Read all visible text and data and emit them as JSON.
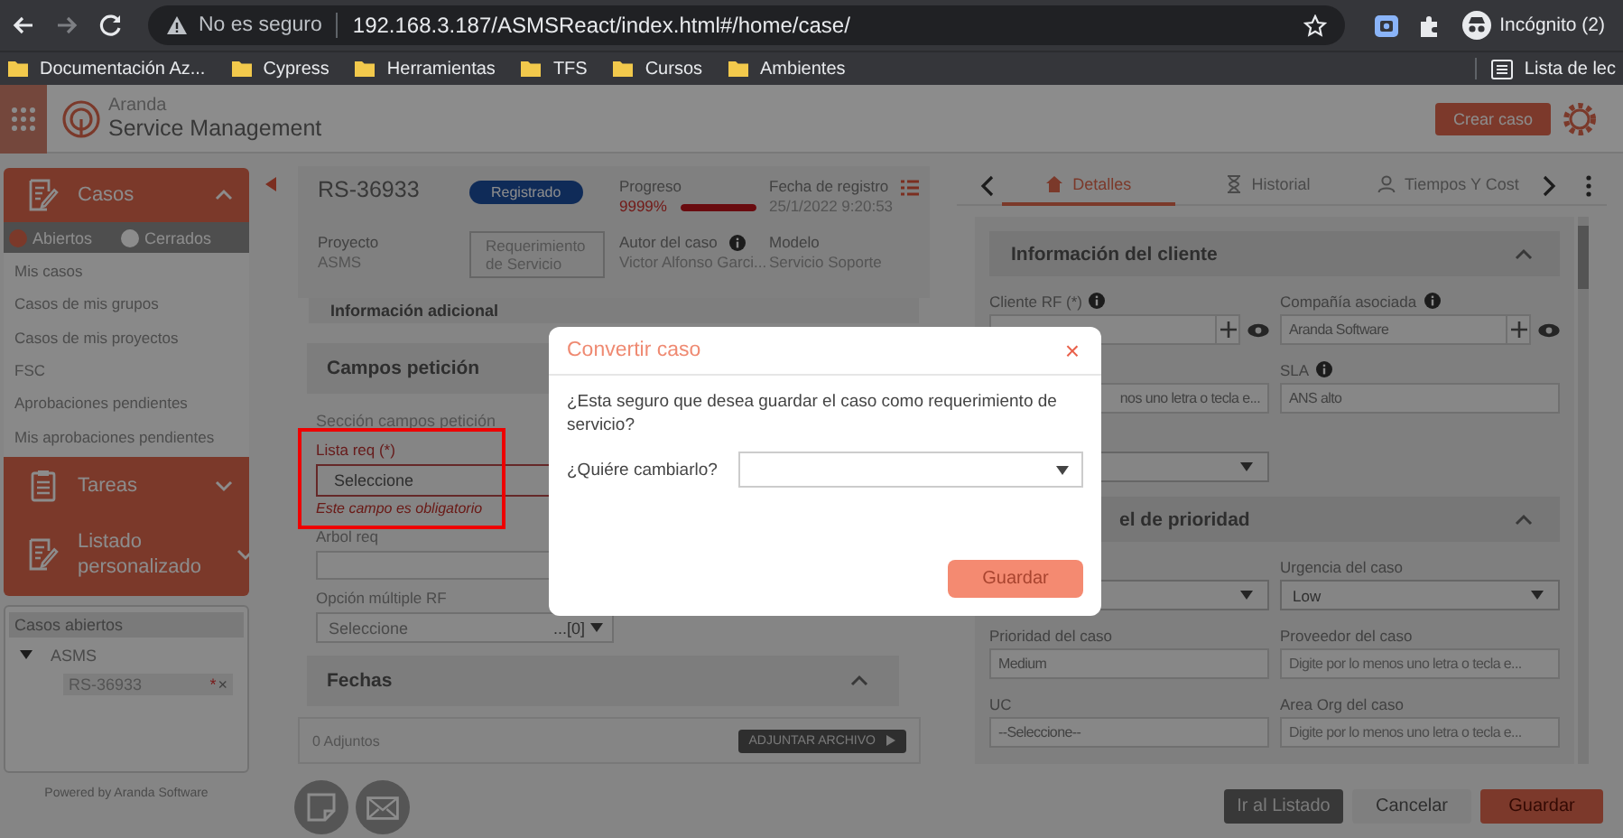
{
  "browser": {
    "security": "No es seguro",
    "url": "192.168.3.187/ASMSReact/index.html#/home/case/",
    "profile": "Incógnito (2)",
    "bookmarks": [
      "Documentación Az...",
      "Cypress",
      "Herramientas",
      "TFS",
      "Cursos",
      "Ambientes"
    ],
    "reading_list": "Lista de lec"
  },
  "app": {
    "logo_top": "Aranda",
    "logo_bottom": "Service Management",
    "create_button": "Crear caso"
  },
  "sidebar": {
    "sections": [
      {
        "kind": "casos",
        "label": "Casos",
        "expanded": true,
        "filters": [
          {
            "label": "Abiertos",
            "selected": true
          },
          {
            "label": "Cerrados",
            "selected": false
          }
        ],
        "items": [
          "Mis casos",
          "Casos de mis grupos",
          "Casos de mis proyectos",
          "FSC",
          "Aprobaciones pendientes",
          "Mis aprobaciones pendientes"
        ]
      },
      {
        "kind": "tareas",
        "label": "Tareas",
        "expanded": false
      },
      {
        "kind": "listado",
        "label": "Listado personalizado",
        "expanded": false
      }
    ],
    "open_cases": {
      "title": "Casos abiertos",
      "groups": [
        {
          "label": "ASMS",
          "expanded": true,
          "children": [
            {
              "label": "RS-36933",
              "unsaved_mark": "*",
              "close": "×"
            }
          ]
        }
      ]
    },
    "footer": "Powered by Aranda Software"
  },
  "case_header": {
    "id": "RS-36933",
    "status": "Registrado",
    "progress_label": "Progreso",
    "progress_value": "9999%",
    "progress": {
      "level": 1
    },
    "date_label": "Fecha de registro",
    "date": "25/1/2022 9:20:53",
    "project_label": "Proyecto",
    "project": "ASMS",
    "type": "Requerimiento de Servicio",
    "author_label": "Autor del caso",
    "author": "Victor Alfonso Garci...",
    "model_label": "Modelo",
    "model": "Servicio Soporte"
  },
  "request_form": {
    "info_section": "Información adicional",
    "fields_section": {
      "title": "Campos petición",
      "caption": "Sección campos petición",
      "fields": [
        {
          "kind": "select",
          "label": "Lista req (*)",
          "value": "Seleccione",
          "error": "Este campo es obligatorio"
        },
        {
          "kind": "text",
          "label": "Arbol req"
        },
        {
          "kind": "multiselect",
          "label": "Opción múltiple RF",
          "value": "Seleccione",
          "count": "...[0]"
        }
      ]
    },
    "dates_section": {
      "title": "Fechas",
      "expanded": true
    },
    "attachments": {
      "count": "0 Adjuntos",
      "button": "ADJUNTAR ARCHIVO"
    }
  },
  "actions": [
    {
      "kind": "note"
    },
    {
      "kind": "email"
    }
  ],
  "details": {
    "tabs": [
      {
        "kind": "details",
        "label": "Detalles",
        "selected": true
      },
      {
        "kind": "history",
        "label": "Historial",
        "selected": false
      },
      {
        "kind": "times",
        "label": "Tiempos Y Cost",
        "selected": false
      }
    ],
    "sections": [
      {
        "title": "Información del cliente",
        "expanded": true,
        "rows": [
          [
            {
              "kind": "lookup",
              "label": "Cliente RF (*)",
              "info": true
            },
            {
              "kind": "lookup",
              "label": "Compañía asociada",
              "info": true,
              "value": "Aranda Software"
            }
          ],
          [
            {
              "kind": "text",
              "value": "nos uno letra o tecla e..."
            },
            {
              "kind": "text",
              "label": "SLA",
              "info": true,
              "value": "ANS alto"
            }
          ],
          [
            {
              "kind": "select"
            }
          ]
        ]
      },
      {
        "title": "el de prioridad",
        "expanded": true,
        "rows": [
          [
            {
              "kind": "select"
            },
            {
              "kind": "select",
              "label": "Urgencia del caso",
              "value": "Low"
            }
          ],
          [
            {
              "kind": "text",
              "label": "Prioridad del caso",
              "value": "Medium"
            },
            {
              "kind": "text",
              "label": "Proveedor del caso",
              "placeholder": "Digite por lo menos uno letra o tecla e..."
            }
          ],
          [
            {
              "kind": "text",
              "label": "UC",
              "value": "--Seleccione--"
            },
            {
              "kind": "text",
              "label": "Area Org del caso",
              "placeholder": "Digite por lo menos uno letra o tecla e..."
            }
          ]
        ]
      }
    ]
  },
  "footer_buttons": [
    {
      "kind": "dark",
      "label": "Ir al Listado"
    },
    {
      "kind": "light",
      "label": "Cancelar"
    },
    {
      "kind": "primary",
      "label": "Guardar"
    }
  ],
  "modal": {
    "title": "Convertir caso",
    "close": "×",
    "message": "¿Esta seguro que desea guardar el caso como requerimiento de servicio?",
    "field_label": "¿Quiére cambiarlo?",
    "button": "Guardar"
  }
}
